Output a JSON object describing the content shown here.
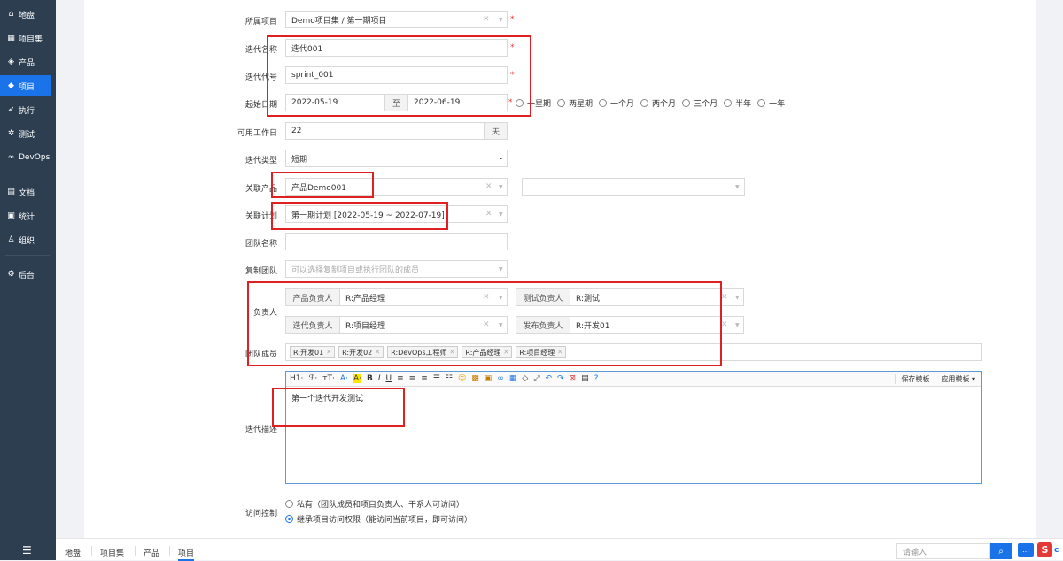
{
  "sidebar": {
    "items": [
      {
        "label": "地盘",
        "icon": "home-icon",
        "glyph": "⌂"
      },
      {
        "label": "项目集",
        "icon": "grid-icon",
        "glyph": "▦"
      },
      {
        "label": "产品",
        "icon": "product-icon",
        "glyph": "◈"
      },
      {
        "label": "项目",
        "icon": "project-icon",
        "glyph": "◆"
      },
      {
        "label": "执行",
        "icon": "rocket-icon",
        "glyph": "➶"
      },
      {
        "label": "测试",
        "icon": "bug-icon",
        "glyph": "✲"
      },
      {
        "label": "DevOps",
        "icon": "devops-icon",
        "glyph": "∞"
      },
      {
        "label": "文档",
        "icon": "doc-icon",
        "glyph": "▤"
      },
      {
        "label": "统计",
        "icon": "stats-icon",
        "glyph": "▣"
      },
      {
        "label": "组织",
        "icon": "org-icon",
        "glyph": "♙"
      },
      {
        "label": "后台",
        "icon": "gear-icon",
        "glyph": "⚙"
      }
    ],
    "active_index": 3,
    "toggle_glyph": "☰"
  },
  "form": {
    "parent_label": "所属项目",
    "parent_value": "Demo项目集 / 第一期项目",
    "name_label": "迭代名称",
    "name_value": "迭代001",
    "code_label": "迭代代号",
    "code_value": "sprint_001",
    "dates_label": "起始日期",
    "begin": "2022-05-19",
    "to": "至",
    "end": "2022-06-19",
    "durations": [
      "一星期",
      "两星期",
      "一个月",
      "两个月",
      "三个月",
      "半年",
      "一年"
    ],
    "days_label": "可用工作日",
    "days_value": "22",
    "days_unit": "天",
    "type_label": "迭代类型",
    "type_value": "短期",
    "product_label": "关联产品",
    "product_value": "产品Demo001",
    "plan_label": "关联计划",
    "plan_value": "第一期计划 [2022-05-19 ~ 2022-07-19]",
    "team_name_label": "团队名称",
    "copy_team_label": "复制团队",
    "copy_team_placeholder": "可以选择复制项目或执行团队的成员",
    "owner_label": "负责人",
    "po_label": "产品负责人",
    "po_value": "R:产品经理",
    "qa_label": "测试负责人",
    "qa_value": "R:测试",
    "pm_label": "迭代负责人",
    "pm_value": "R:项目经理",
    "rd_label": "发布负责人",
    "rd_value": "R:开发01",
    "members_label": "团队成员",
    "members": [
      "R:开发01",
      "R:开发02",
      "R:DevOps工程师",
      "R:产品经理",
      "R:项目经理"
    ],
    "desc_label": "迭代描述",
    "desc_value": "第一个迭代开发测试",
    "acl_label": "访问控制",
    "acl_options": [
      "私有（团队成员和项目负责人、干系人可访问）",
      "继承项目访问权限（能访问当前项目，即可访问）"
    ],
    "acl_selected": 1
  },
  "editor": {
    "tools": [
      "H1·",
      "ℱ·",
      "тT·",
      "A·",
      "A·",
      "B",
      "I",
      "U"
    ],
    "save_template": "保存模板",
    "apply_template": "应用模板"
  },
  "bottombar": {
    "crumbs": [
      "地盘",
      "项目集",
      "产品",
      "项目"
    ],
    "search_placeholder": "请输入"
  },
  "colors": {
    "accent": "#1a73e8",
    "sidebar": "#2c3e50",
    "annotation": "#e02020"
  }
}
